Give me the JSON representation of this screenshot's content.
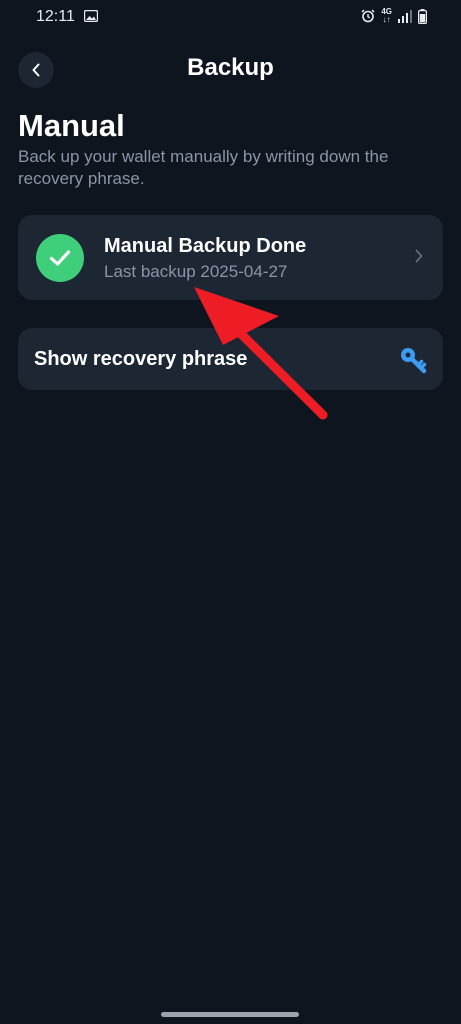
{
  "status_bar": {
    "time": "12:11",
    "network_top": "4G",
    "network_bottom": "↓↑"
  },
  "header": {
    "title": "Backup",
    "back_icon": "chevron-left-icon"
  },
  "section": {
    "title": "Manual",
    "description": "Back up your wallet manually by writing down the recovery phrase."
  },
  "backup_card": {
    "title": "Manual Backup Done",
    "subtitle": "Last backup 2025-04-27",
    "status_icon": "check-icon",
    "status_color": "#3fcf7a"
  },
  "recovery_card": {
    "label": "Show recovery phrase",
    "icon": "key-icon",
    "icon_color": "#3d9bf0"
  },
  "colors": {
    "background": "#0f151f",
    "card": "#1d2633",
    "annotation_arrow": "#ee1c24"
  }
}
